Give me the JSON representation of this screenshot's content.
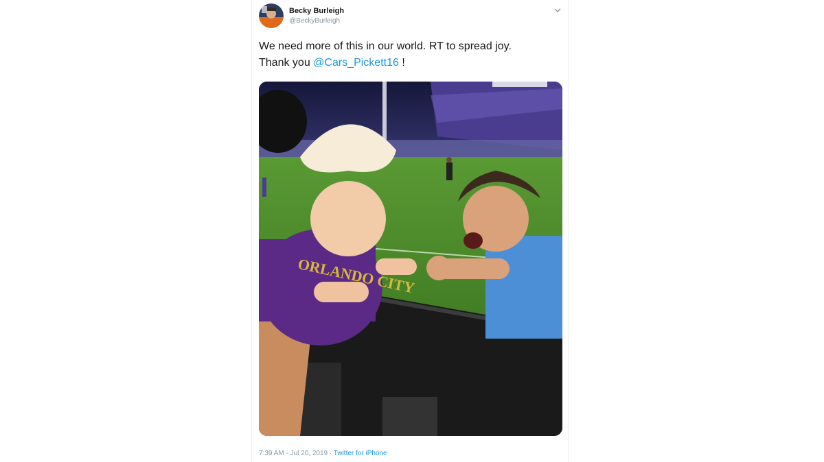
{
  "tweet": {
    "author": {
      "display_name": "Becky Burleigh",
      "handle": "@BeckyBurleigh"
    },
    "text_line1": "We need more of this in our world. RT to spread joy.",
    "text_line2_prefix": "Thank you ",
    "mention": "@Cars_Pickett16",
    "text_line2_suffix": " !",
    "timestamp": "7:39 AM - Jul 20, 2019",
    "separator": " · ",
    "source": "Twitter for iPhone",
    "photo_jersey_text": "ORLANDO CITY"
  },
  "colors": {
    "link": "#1b95e0",
    "text": "#14171a",
    "muted": "#8899a6",
    "pitch": "#4f8a2c",
    "kid_shirt": "#5b2a86",
    "player_kit": "#4d8fd6"
  },
  "icons": {
    "more": "chevron-down-icon"
  }
}
